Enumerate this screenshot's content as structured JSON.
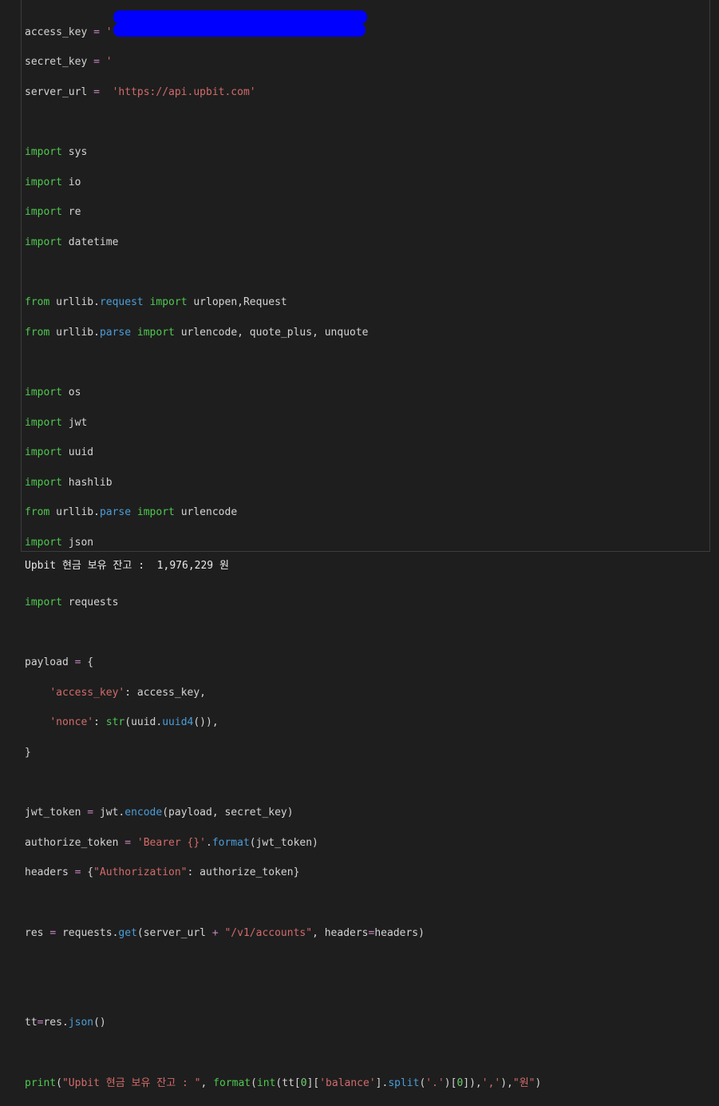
{
  "code": {
    "access_key_var": "access_key",
    "secret_key_var": "secret_key",
    "server_url_var": "server_url",
    "eq": "=",
    "quote": "'",
    "server_url_value": "'https://api.upbit.com'",
    "imports_1": [
      "sys",
      "io",
      "re",
      "datetime"
    ],
    "from_1_module": "urllib",
    "from_1_sub": "request",
    "from_1_names": "urlopen,Request",
    "from_2_module": "urllib",
    "from_2_sub": "parse",
    "from_2_names": "urlencode, quote_plus, unquote",
    "imports_2": [
      "os",
      "jwt",
      "uuid",
      "hashlib"
    ],
    "from_3_module": "urllib",
    "from_3_sub": "parse",
    "from_3_names": "urlencode",
    "import_json": "json",
    "import_requests": "requests",
    "kw_import": "import",
    "kw_from": "from"
  },
  "output": {
    "text": "Upbit 현금 보유 잔고 :  1,976,229 원"
  },
  "colors": {
    "background": "#1e1e1e",
    "keyword": "#4ec94e",
    "string": "#d36a6a",
    "redaction": "#0000ff"
  }
}
